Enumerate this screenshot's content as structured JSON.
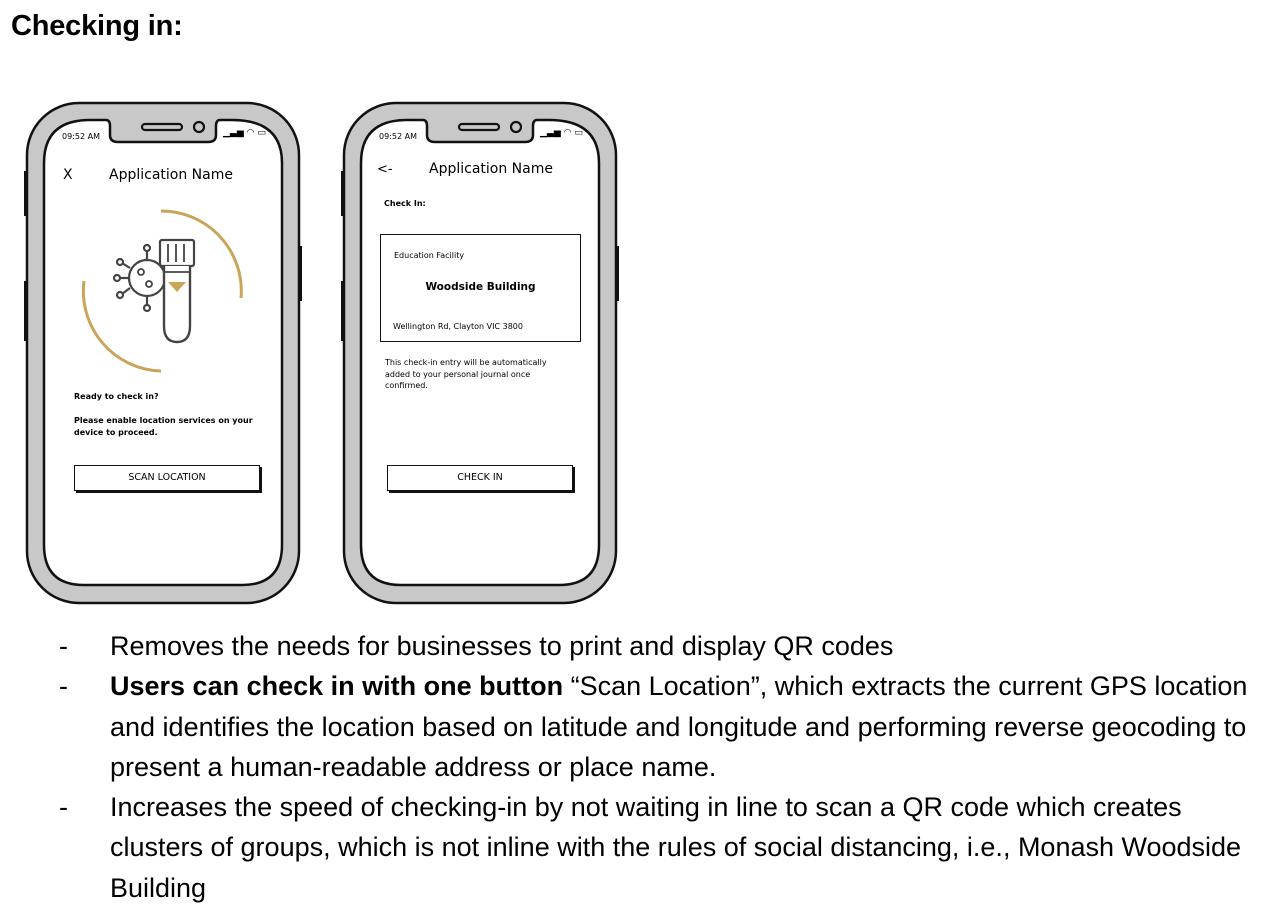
{
  "heading": "Checking in:",
  "phone1": {
    "time": "09:52 AM",
    "close_icon": "X",
    "app_name": "Application Name",
    "prompt_title": "Ready to check in?",
    "prompt_body": "Please enable location services on your device to proceed.",
    "button_label": "SCAN LOCATION"
  },
  "phone2": {
    "time": "09:52 AM",
    "back_icon": "<-",
    "app_name": "Application Name",
    "section_label": "Check In:",
    "card": {
      "category": "Education Facility",
      "name": "Woodside Building",
      "address": "Wellington Rd, Clayton VIC 3800"
    },
    "note": "This check-in entry will be automatically added to your personal journal once confirmed.",
    "button_label": "CHECK IN"
  },
  "bullets": [
    {
      "dash": "-",
      "bold": "",
      "text": "Removes the needs for businesses to print and display QR codes"
    },
    {
      "dash": "-",
      "bold": "Users can check in with one button",
      "text": " “Scan Location”, which extracts the current GPS location and identifies the location based on latitude and longitude and performing reverse geocoding to present a human-readable address or place name."
    },
    {
      "dash": "-",
      "bold": "",
      "text": "Increases the speed of checking-in by not waiting in line to scan a QR code which creates clusters of groups, which is not inline with the rules of social distancing, i.e., Monash Woodside Building"
    }
  ],
  "colors": {
    "accent_gold": "#C9A55A",
    "phone_frame_gray": "#C8C8C8"
  }
}
